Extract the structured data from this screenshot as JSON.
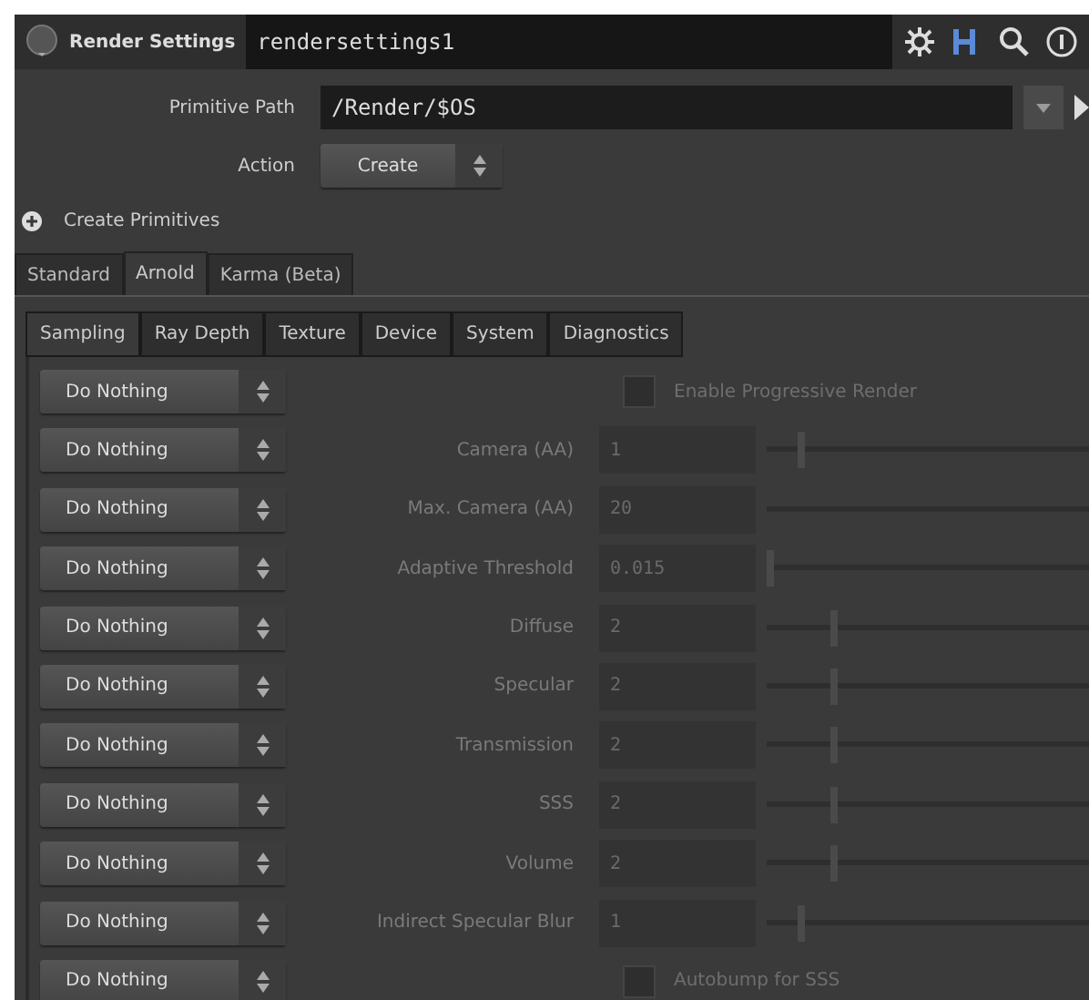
{
  "header": {
    "node_type": "Render Settings",
    "node_name": "rendersettings1"
  },
  "primitive_path": {
    "label": "Primitive Path",
    "value": "/Render/$OS"
  },
  "action": {
    "label": "Action",
    "value": "Create"
  },
  "section": {
    "label": "Create Primitives",
    "expanded": false
  },
  "tabs": [
    {
      "label": "Standard",
      "selected": false
    },
    {
      "label": "Arnold",
      "selected": true
    },
    {
      "label": "Karma (Beta)",
      "selected": false
    }
  ],
  "subtabs": [
    {
      "label": "Sampling",
      "selected": true
    },
    {
      "label": "Ray Depth",
      "selected": false
    },
    {
      "label": "Texture",
      "selected": false
    },
    {
      "label": "Device",
      "selected": false
    },
    {
      "label": "System",
      "selected": false
    },
    {
      "label": "Diagnostics",
      "selected": false
    }
  ],
  "rows": [
    {
      "kind": "checkbox",
      "action": "Do Nothing",
      "label": "Enable Progressive Render",
      "checked": false,
      "disabled": true
    },
    {
      "kind": "param",
      "action": "Do Nothing",
      "label": "Camera (AA)",
      "value": "1",
      "level": 0.1,
      "disabled": true
    },
    {
      "kind": "param",
      "action": "Do Nothing",
      "label": "Max. Camera (AA)",
      "value": "20",
      "disabled": true
    },
    {
      "kind": "param",
      "action": "Do Nothing",
      "label": "Adaptive Threshold",
      "value": "0.015",
      "level": 0,
      "disabled": true
    },
    {
      "kind": "param",
      "action": "Do Nothing",
      "label": "Diffuse",
      "value": "2",
      "level": 0.2,
      "disabled": true
    },
    {
      "kind": "param",
      "action": "Do Nothing",
      "label": "Specular",
      "value": "2",
      "level": 0.2,
      "disabled": true
    },
    {
      "kind": "param",
      "action": "Do Nothing",
      "label": "Transmission",
      "value": "2",
      "level": 0.2,
      "disabled": true
    },
    {
      "kind": "param",
      "action": "Do Nothing",
      "label": "SSS",
      "value": "2",
      "level": 0.2,
      "disabled": true
    },
    {
      "kind": "param",
      "action": "Do Nothing",
      "label": "Volume",
      "value": "2",
      "level": 0.2,
      "disabled": true
    },
    {
      "kind": "param",
      "action": "Do Nothing",
      "label": "Indirect Specular Blur",
      "value": "1",
      "level": 0.1,
      "disabled": true
    },
    {
      "kind": "checkbox",
      "action": "Do Nothing",
      "label": "Autobump for SSS",
      "checked": false,
      "disabled": true
    }
  ]
}
